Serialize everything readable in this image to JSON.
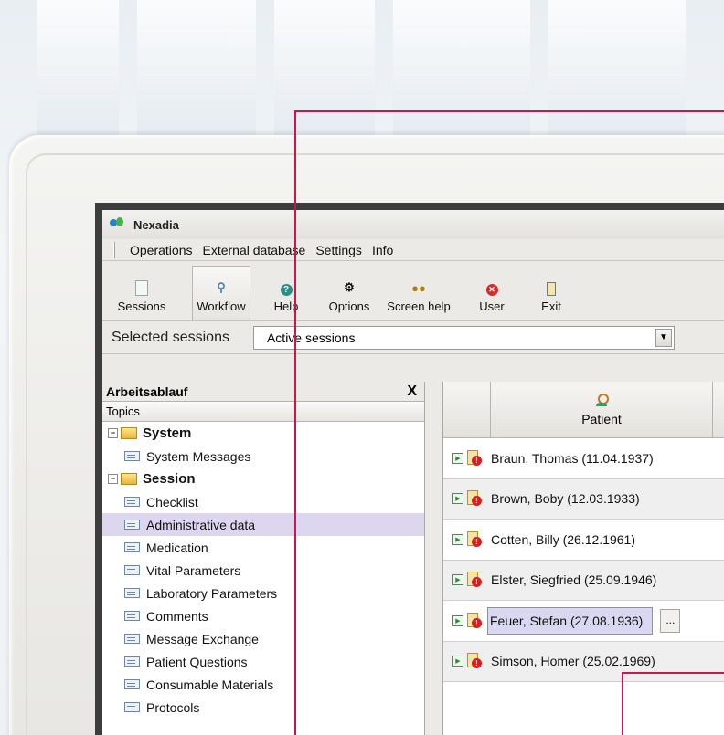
{
  "window": {
    "title": "Nexadia"
  },
  "menu": [
    "Operations",
    "External database",
    "Settings",
    "Info"
  ],
  "toolbar": [
    {
      "label": "Sessions",
      "icon": "sessions-icon"
    },
    {
      "label": "Workflow",
      "icon": "workflow-icon"
    },
    {
      "label": "Help",
      "icon": "help-icon"
    },
    {
      "label": "Options",
      "icon": "options-icon"
    },
    {
      "label": "Screen help",
      "icon": "screen-help-icon"
    },
    {
      "label": "User",
      "icon": "user-icon"
    },
    {
      "label": "Exit",
      "icon": "exit-icon"
    }
  ],
  "filter": {
    "label": "Selected sessions",
    "value": "Active sessions"
  },
  "left_panel": {
    "title": "Arbeitsablauf",
    "close": "X",
    "topics_header": "Topics",
    "groups": [
      {
        "name": "System",
        "items": [
          "System Messages"
        ]
      },
      {
        "name": "Session",
        "items": [
          "Checklist",
          "Administrative data",
          "Medication",
          "Vital Parameters",
          "Laboratory Parameters",
          "Comments",
          "Message Exchange",
          "Patient Questions",
          "Consumable Materials",
          "Protocols"
        ]
      }
    ],
    "selected_item": "Administrative data"
  },
  "patient_grid": {
    "column_header": "Patient",
    "rows": [
      "Braun, Thomas (11.04.1937)",
      "Brown, Boby (12.03.1933)",
      "Cotten, Billy (26.12.1961)",
      "Elster, Siegfried (25.09.1946)",
      "Feuer, Stefan (27.08.1936)",
      "Simson, Homer (25.02.1969)"
    ],
    "active_row": "Feuer, Stefan (27.08.1936)",
    "ellipsis": "..."
  },
  "colors": {
    "accent_line": "#c8174d",
    "selection": "#dcd7ee"
  }
}
